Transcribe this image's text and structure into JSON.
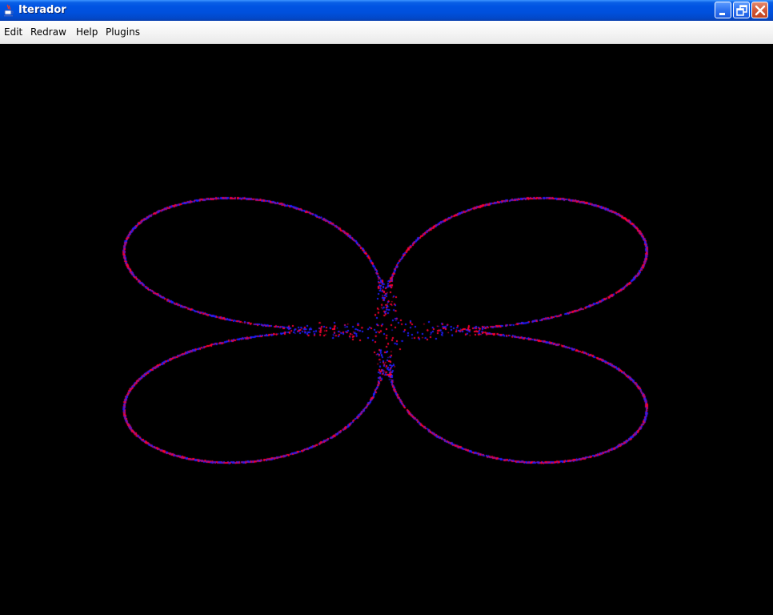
{
  "window": {
    "title": "Iterador",
    "icon": "java-cup-icon"
  },
  "controls": {
    "minimize_icon": "minimize-icon",
    "maximize_icon": "restore-icon",
    "close_icon": "close-icon"
  },
  "menubar": {
    "items": [
      {
        "label": "Edit"
      },
      {
        "label": "Redraw"
      },
      {
        "label": "Help"
      },
      {
        "label": "Plugins"
      }
    ]
  },
  "canvas": {
    "background": "#000000",
    "point_colors": [
      "#ff0033",
      "#2222ff"
    ]
  }
}
